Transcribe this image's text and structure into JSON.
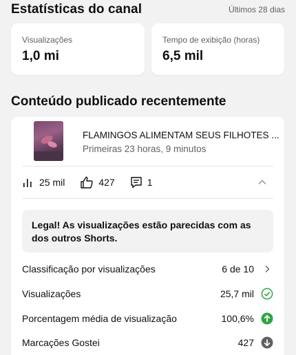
{
  "channel_stats": {
    "title": "Estatísticas do canal",
    "period": "Últimos 28 dias",
    "cards": [
      {
        "label": "Visualizações",
        "value": "1,0 mi"
      },
      {
        "label": "Tempo de exibição (horas)",
        "value": "6,5 mil"
      }
    ]
  },
  "recent": {
    "title": "Conteúdo publicado recentemente",
    "video": {
      "title": "FLAMINGOS ALIMENTAM SEUS FILHOTES ...",
      "subtitle": "Primeiras 23 horas, 9 minutos"
    },
    "metrics": {
      "views": "25 mil",
      "likes": "427",
      "comments": "1"
    },
    "banner": "Legal! As visualizações estão parecidas com as dos outros Shorts.",
    "rows": [
      {
        "label": "Classificação por visualizações",
        "value": "6 de 10",
        "icon": "chevron-right-icon"
      },
      {
        "label": "Visualizações",
        "value": "25,7 mil",
        "icon": "check-circle-icon"
      },
      {
        "label": "Porcentagem média de visualização",
        "value": "100,6%",
        "icon": "arrow-up-circle-icon"
      },
      {
        "label": "Marcações Gostei",
        "value": "427",
        "icon": "arrow-down-circle-icon"
      }
    ]
  },
  "colors": {
    "green": "#2ba640",
    "gray_icon": "#606060",
    "background": "#f2f2f2"
  }
}
